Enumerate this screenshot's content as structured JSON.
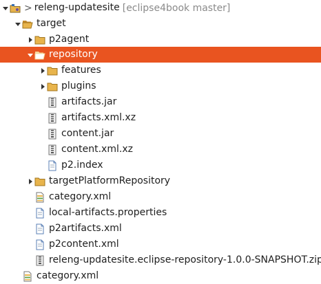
{
  "tree": {
    "project": {
      "prefix": ">",
      "name": "releng-updatesite",
      "decoration": "[eclipse4book master]"
    },
    "items": [
      {
        "label": "target"
      },
      {
        "label": "p2agent"
      },
      {
        "label": "repository"
      },
      {
        "label": "features"
      },
      {
        "label": "plugins"
      },
      {
        "label": "artifacts.jar"
      },
      {
        "label": "artifacts.xml.xz"
      },
      {
        "label": "content.jar"
      },
      {
        "label": "content.xml.xz"
      },
      {
        "label": "p2.index"
      },
      {
        "label": "targetPlatformRepository"
      },
      {
        "label": "category.xml"
      },
      {
        "label": "local-artifacts.properties"
      },
      {
        "label": "p2artifacts.xml"
      },
      {
        "label": "p2content.xml"
      },
      {
        "label": "releng-updatesite.eclipse-repository-1.0.0-SNAPSHOT.zip"
      },
      {
        "label": "category.xml"
      }
    ]
  },
  "colors": {
    "selection": "#e95420",
    "folder": "#e8b44c",
    "text": "#1e1e1e",
    "decoration": "#8a8a8a"
  },
  "icons": [
    "expanded-arrow-icon",
    "collapsed-arrow-icon",
    "project-icon",
    "folder-icon",
    "folder-open-icon",
    "jar-icon",
    "xz-icon",
    "file-icon",
    "xml-icon",
    "properties-icon",
    "zip-icon"
  ]
}
